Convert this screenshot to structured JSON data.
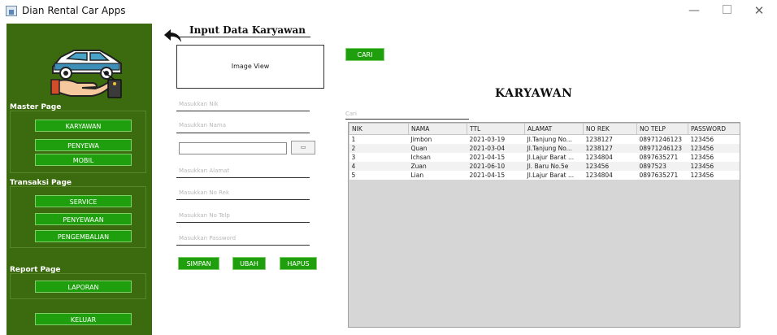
{
  "window": {
    "title": "Dian Rental Car Apps",
    "minimize": "—",
    "close": "✕"
  },
  "sidebar": {
    "master_title": "Master Page",
    "master_items": [
      "KARYAWAN",
      "PENYEWA",
      "MOBIL"
    ],
    "transaksi_title": "Transaksi Page",
    "transaksi_items": [
      "SERVICE",
      "PENYEWAAN",
      "PENGEMBALIAN"
    ],
    "report_title": "Report Page",
    "report_items": [
      "LAPORAN"
    ],
    "logout_label": "KELUAR"
  },
  "form": {
    "title": "Input Data Karyawan",
    "image_view": "Image View",
    "nik_placeholder": "Masukkan Nik",
    "nama_placeholder": "Masukkan Nama",
    "browse_button": "▭",
    "alamat_placeholder": "Masukkan Alamat",
    "norek_placeholder": "Masukkan No Rek",
    "notelp_placeholder": "Masukkan No Telp",
    "password_placeholder": "Masukkan Password",
    "save_label": "SIMPAN",
    "update_label": "UBAH",
    "delete_label": "HAPUS"
  },
  "search": {
    "button_label": "CARI",
    "placeholder": "Cari"
  },
  "main": {
    "heading": "KARYAWAN"
  },
  "table": {
    "columns": [
      "NIK",
      "NAMA",
      "TTL",
      "ALAMAT",
      "NO REK",
      "NO TELP",
      "PASSWORD"
    ],
    "rows": [
      [
        "1",
        "Jimbon",
        "2021-03-19",
        "Jl.Tanjung No...",
        "1238127",
        "08971246123",
        "123456"
      ],
      [
        "2",
        "Quan",
        "2021-03-04",
        "Jl.Tanjung No...",
        "1238127",
        "08971246123",
        "123456"
      ],
      [
        "3",
        "Ichsan",
        "2021-04-15",
        "Jl.Lajur Barat ...",
        "1234804",
        "0897635271",
        "123456"
      ],
      [
        "4",
        "Zuan",
        "2021-06-10",
        "Jl. Baru No.5e",
        "123456",
        "0897523",
        "123456"
      ],
      [
        "5",
        "Lian",
        "2021-04-15",
        "Jl.Lajur Barat ...",
        "1234804",
        "0897635271",
        "123456"
      ]
    ]
  },
  "colors": {
    "sidebar_bg": "#3c6b0f",
    "button_green": "#1f9f0d",
    "table_bg": "#d6d6d6"
  }
}
